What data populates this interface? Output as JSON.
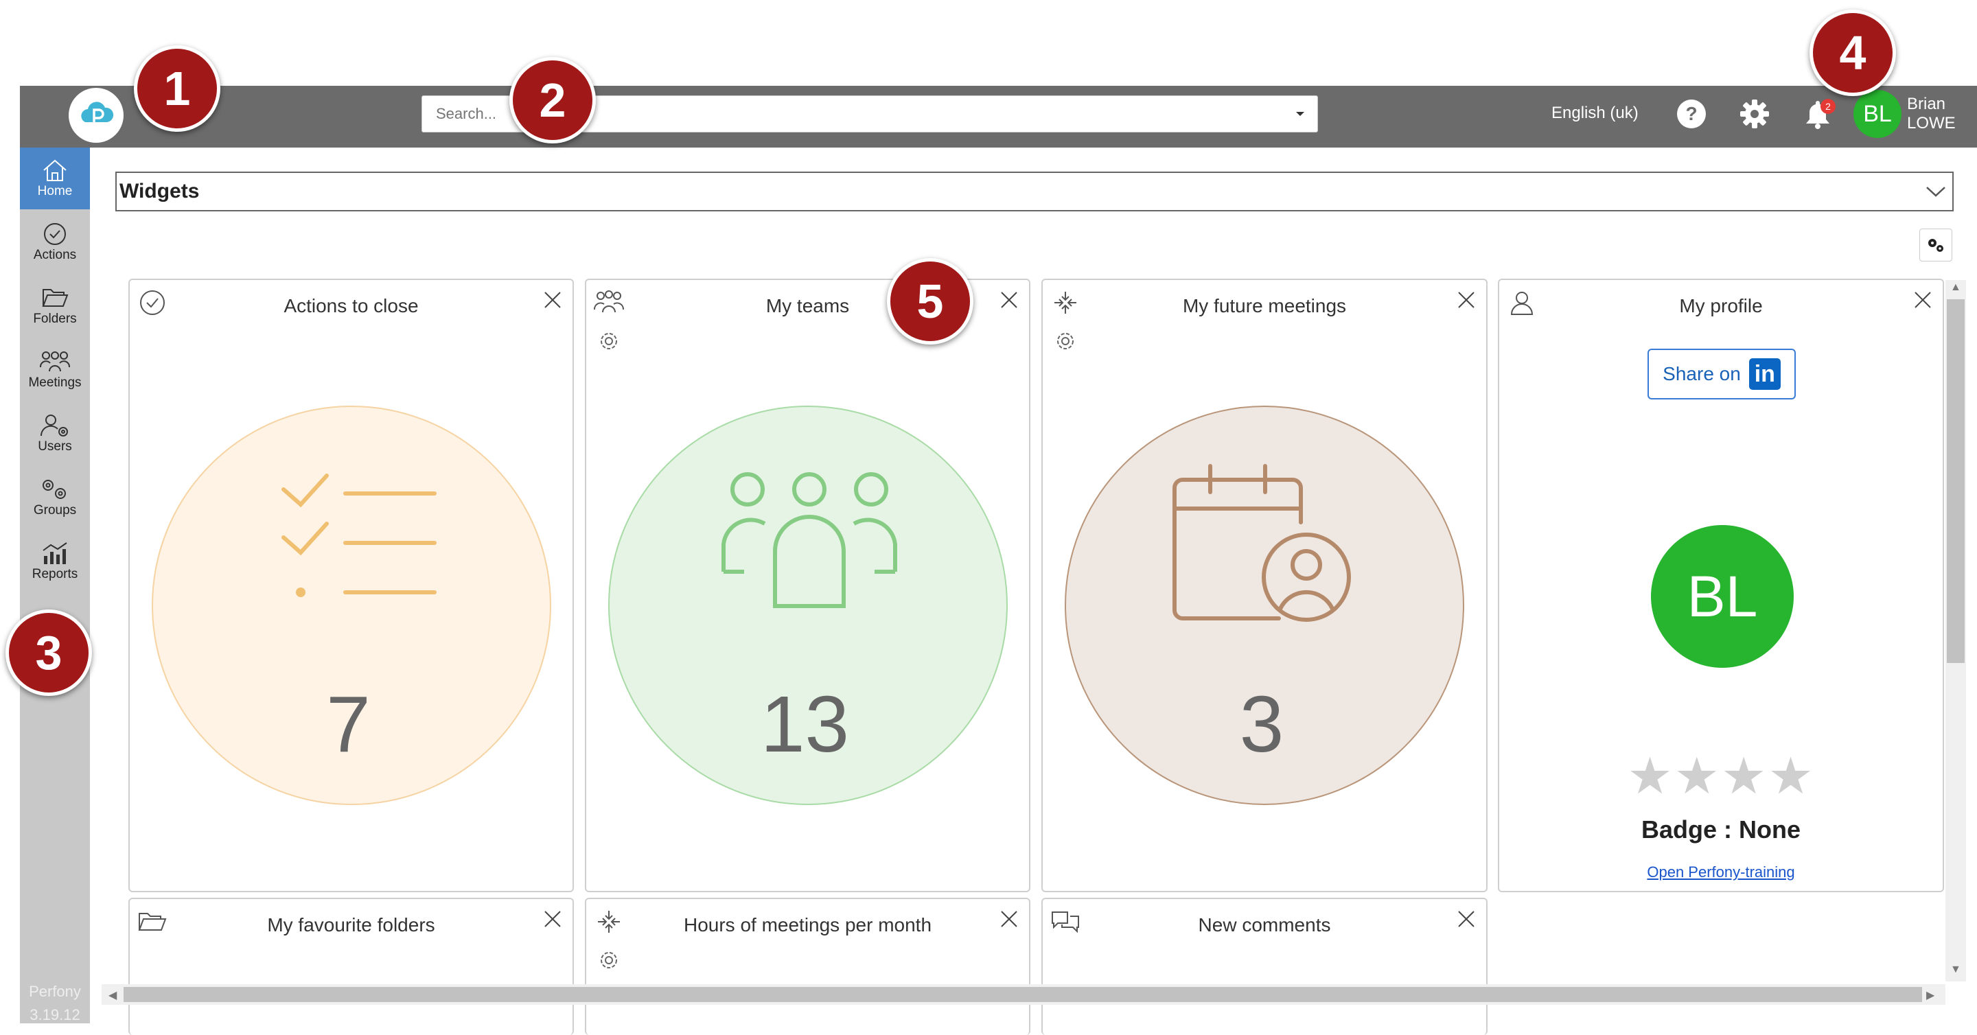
{
  "topbar": {
    "search_placeholder": "Search...",
    "language": "English (uk)",
    "notification_count": "2",
    "user_initials": "BL",
    "user_first": "Brian",
    "user_last": "LOWE"
  },
  "sidebar": {
    "items": [
      {
        "label": "Home",
        "icon": "home-icon"
      },
      {
        "label": "Actions",
        "icon": "check-circle-icon"
      },
      {
        "label": "Folders",
        "icon": "folder-icon"
      },
      {
        "label": "Meetings",
        "icon": "people-icon"
      },
      {
        "label": "Users",
        "icon": "user-gear-icon"
      },
      {
        "label": "Groups",
        "icon": "gears-icon"
      },
      {
        "label": "Reports",
        "icon": "chart-icon"
      }
    ],
    "version_app": "Perfony",
    "version_number": "3.19.12"
  },
  "widgets_header": {
    "title": "Widgets"
  },
  "cards": {
    "actions": {
      "title": "Actions to close",
      "value": "7"
    },
    "teams": {
      "title": "My teams",
      "value": "13"
    },
    "meetings": {
      "title": "My future meetings",
      "value": "3"
    },
    "profile": {
      "title": "My profile",
      "share_label": "Share on",
      "linkedin": "in",
      "initials": "BL",
      "stars": "★★★★",
      "badge": "Badge : None",
      "training_link": "Open Perfony-training"
    },
    "favourite_folders": {
      "title": "My favourite folders"
    },
    "hours_meetings": {
      "title": "Hours of meetings per month"
    },
    "new_comments": {
      "title": "New comments"
    }
  },
  "callouts": [
    "1",
    "2",
    "3",
    "4",
    "5"
  ],
  "colors": {
    "topbar": "#6b6b6b",
    "sidebar": "#c8c8c8",
    "active_nav": "#4a86c8",
    "avatar_green": "#27b42f",
    "callout_red": "#a01818"
  }
}
